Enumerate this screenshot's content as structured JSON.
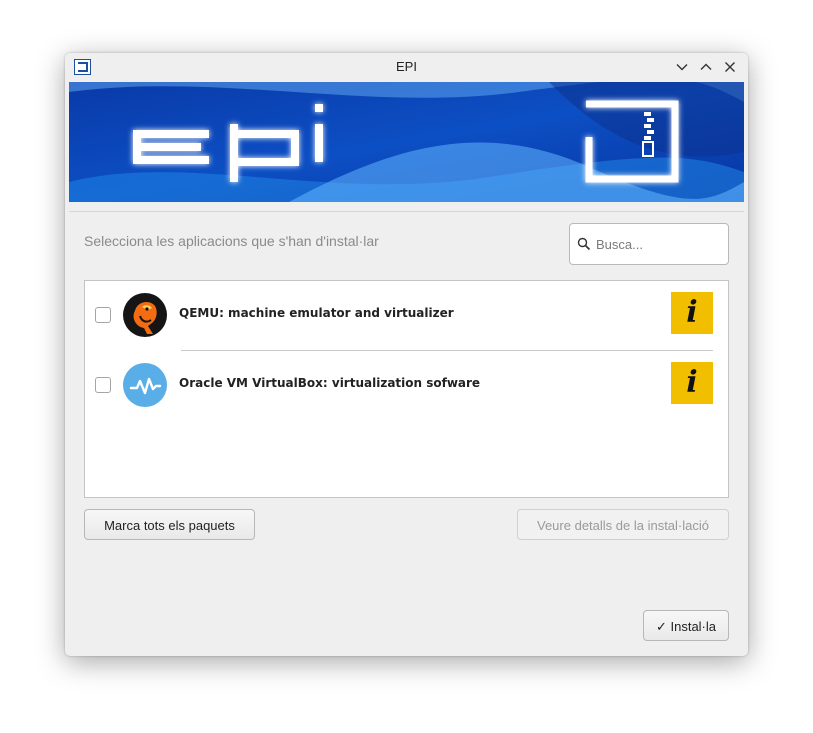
{
  "window": {
    "title": "EPI",
    "controls": [
      "minimize-icon",
      "maximize-icon",
      "close-icon"
    ]
  },
  "banner": {
    "brand_color": "#0a36a8",
    "accent_color": "#5fb3ff"
  },
  "main": {
    "prompt": "Selecciona les aplicacions que s'han d'instal·lar",
    "search": {
      "placeholder": "Busca...",
      "value": ""
    }
  },
  "packages": [
    {
      "label": "QEMU: machine emulator and virtualizer",
      "checked": false,
      "icon": "qemu-logo-icon"
    },
    {
      "label": "Oracle VM VirtualBox: virtualization sofware",
      "checked": false,
      "icon": "virtualbox-logo-icon"
    }
  ],
  "buttons": {
    "mark_all": "Marca tots els paquets",
    "details": "Veure detalls de la instal·lació",
    "install": "✓ Instal·la"
  },
  "colors": {
    "info_badge": "#f2bf00",
    "window_bg": "#efefef"
  }
}
